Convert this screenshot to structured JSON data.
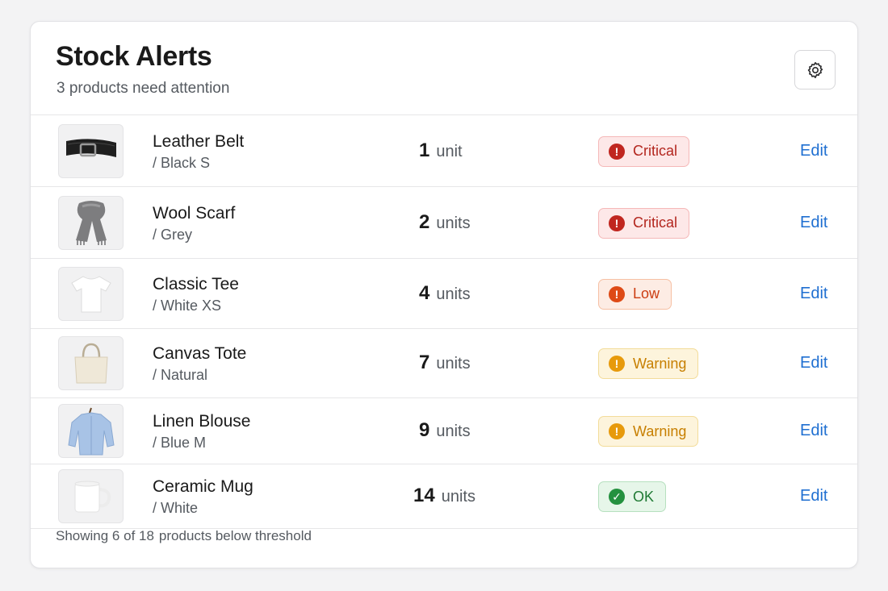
{
  "header": {
    "title": "Stock Alerts",
    "subtitle": "3 products need attention",
    "settings_icon": "gear-icon"
  },
  "products": [
    {
      "name": "Leather Belt",
      "variant": "/ Black S",
      "qty": "1",
      "unit": "unit",
      "status": "Critical",
      "status_icon": "alert-circle-icon",
      "action": "Edit",
      "image": "belt"
    },
    {
      "name": "Wool Scarf",
      "variant": "/ Grey",
      "qty": "2",
      "unit": "units",
      "status": "Critical",
      "status_icon": "alert-circle-icon",
      "action": "Edit",
      "image": "scarf"
    },
    {
      "name": "Classic Tee",
      "variant": "/ White XS",
      "qty": "4",
      "unit": "units",
      "status": "Low",
      "status_icon": "alert-circle-icon",
      "action": "Edit",
      "image": "tee"
    },
    {
      "name": "Canvas Tote",
      "variant": "/ Natural",
      "qty": "7",
      "unit": "units",
      "status": "Warning",
      "status_icon": "alert-circle-icon",
      "action": "Edit",
      "image": "tote"
    },
    {
      "name": "Linen Blouse",
      "variant": "/ Blue M",
      "qty": "9",
      "unit": "units",
      "status": "Warning",
      "status_icon": "alert-circle-icon",
      "action": "Edit",
      "image": "blouse"
    },
    {
      "name": "Ceramic Mug",
      "variant": "/ White",
      "qty": "14",
      "unit": "units",
      "status": "OK",
      "status_icon": "check-circle-icon",
      "action": "Edit",
      "image": "mug"
    }
  ],
  "footer": {
    "showing": "Showing 6 of 18",
    "suffix": "products below threshold"
  },
  "colors": {
    "critical": "#c0261f",
    "low": "#de4a16",
    "warning": "#e79a0c",
    "ok": "#24913f",
    "link": "#1f6fd1"
  }
}
